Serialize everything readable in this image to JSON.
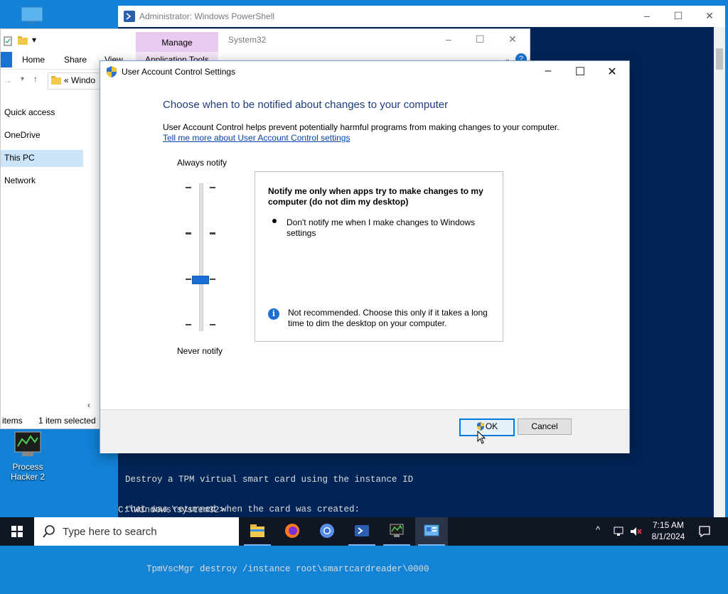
{
  "desktop": {
    "icons": [
      {
        "label": "Process Hacker 2"
      }
    ]
  },
  "powershell": {
    "title": "Administrator: Windows PowerShell",
    "output_lines": [
      "Destroy a TPM virtual smart card using the instance ID",
      "that was returned when the card was created:",
      "",
      "    TpmVscMgr destroy /instance root\\smartcardreader\\0000"
    ],
    "prompt": "C:\\Windows\\system32>"
  },
  "explorer": {
    "tab_title": "System32",
    "manage_label": "Manage",
    "application_tools_label": "Application Tools",
    "ribbon_tabs": [
      "Home",
      "Share",
      "View"
    ],
    "address_text": "Windo",
    "nav_items": [
      "Quick access",
      "OneDrive",
      "This PC",
      "Network"
    ],
    "status_items": "items",
    "status_selected": "1 item selected"
  },
  "uac": {
    "title": "User Account Control Settings",
    "heading": "Choose when to be notified about changes to your computer",
    "description": "User Account Control helps prevent potentially harmful programs from making changes to your computer.",
    "link": "Tell me more about User Account Control settings",
    "label_top": "Always notify",
    "label_bottom": "Never notify",
    "slider_level": 2,
    "slider_levels": 4,
    "info_heading": "Notify me only when apps try to make changes to my computer (do not dim my desktop)",
    "info_bullet": "Don't notify me when I make changes to Windows settings",
    "info_note": "Not recommended. Choose this only if it takes a long time to dim the desktop on your computer.",
    "ok_label": "OK",
    "cancel_label": "Cancel"
  },
  "taskbar": {
    "search_placeholder": "Type here to search",
    "apps": [
      "file-explorer",
      "firefox",
      "chromium",
      "powershell",
      "process-hacker",
      "control-panel"
    ],
    "time": "7:15 AM",
    "date": "8/1/2024"
  }
}
